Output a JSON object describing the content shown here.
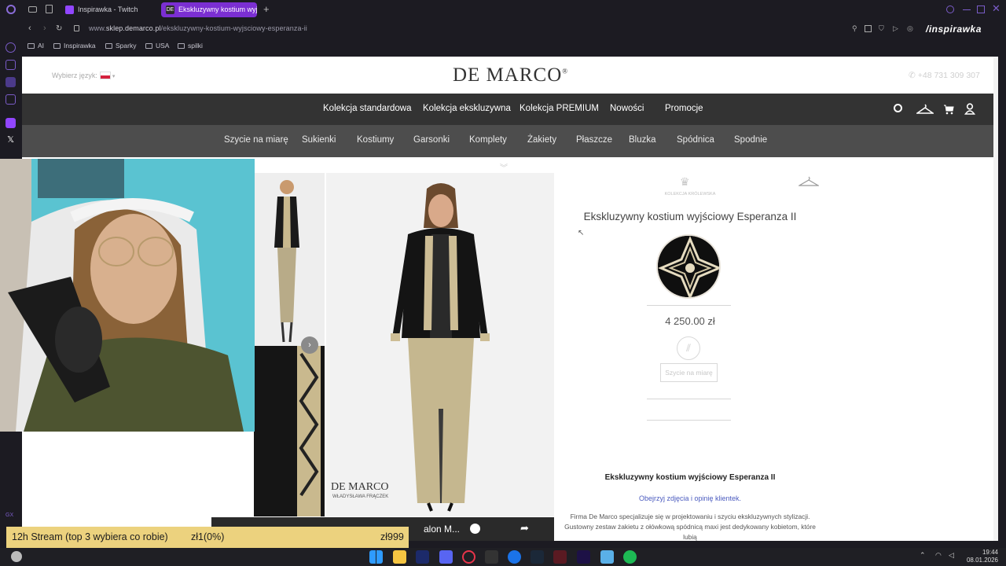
{
  "browser": {
    "tabs": [
      {
        "title": "Inspirawka - Twitch",
        "active": false
      },
      {
        "title": "Ekskluzywny kostium wyjś",
        "active": true
      }
    ],
    "url": {
      "prefix": "www.",
      "domain": "sklep.demarco.pl",
      "path": "/ekskluzywny-kostium-wyjsciowy-esperanza-ii"
    },
    "bookmarks": [
      "AI",
      "Inspirawka",
      "Sparky",
      "USA",
      "spilki"
    ],
    "watermark": "/inspirawka",
    "colors": {
      "chrome_bg": "#1c1b22",
      "active_tab": "#7b2fd2"
    }
  },
  "site": {
    "logo": "DE MARCO",
    "logo_mark": "®",
    "language_label": "Wybierz język:",
    "phone": "+48 731 309 307",
    "main_nav": [
      "Kolekcja standardowa",
      "Kolekcja ekskluzywna",
      "Kolekcja PREMIUM",
      "Nowości",
      "Promocje"
    ],
    "sub_nav": [
      "Szycie na miarę",
      "Sukienki",
      "Kostiumy",
      "Garsonki",
      "Komplety",
      "Żakiety",
      "Płaszcze",
      "Bluzka",
      "Spódnica",
      "Spodnie"
    ],
    "nav_icons": [
      "search-icon",
      "hanger-icon",
      "cart-icon",
      "user-icon"
    ]
  },
  "product": {
    "collection_label": "KOLEKCJA KRÓLEWSKA",
    "title": "Ekskluzywny kostium wyjściowy Esperanza II",
    "price": "4 250.00 zł",
    "size_button": "Szycie na miarę",
    "image_signature": "DE MARCO",
    "image_caption": "WŁADYSŁAWA FRĄCZEK",
    "video_title": "alon M...",
    "description_title": "Ekskluzywny kostium wyjściowy Esperanza II",
    "description_link": "Obejrzyj zdjęcia i opinię klientek.",
    "description_text": "Firma De Marco specjalizuje się w projektowaniu i szyciu ekskluzywnych stylizacji. Gustowny zestaw żakietu z ołówkową spódnicą maxi jest dedykowany kobietom, które lubią"
  },
  "stream": {
    "goal": "12h Stream (top 3 wybiera co robie)",
    "progress": "zł1(0%)",
    "target": "zł999",
    "progress_fraction": 0.01
  },
  "taskbar": {
    "time": "19:44",
    "date": "08.01.2026"
  }
}
